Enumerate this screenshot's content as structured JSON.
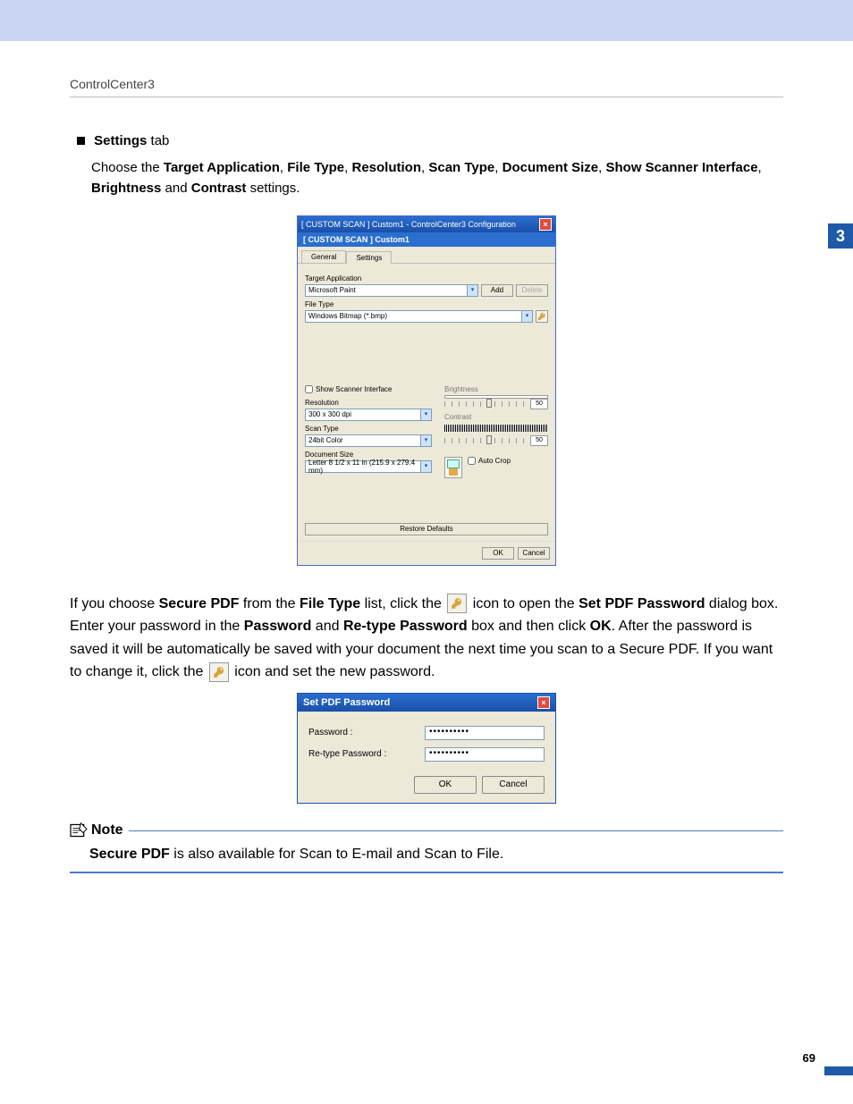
{
  "header": {
    "breadcrumb": "ControlCenter3"
  },
  "chapter_tab": "3",
  "section": {
    "title_bold": "Settings",
    "title_rest": " tab",
    "intro": {
      "pre": "Choose the ",
      "b1": "Target Application",
      "c1": ", ",
      "b2": "File Type",
      "c2": ", ",
      "b3": "Resolution",
      "c3": ", ",
      "b4": "Scan Type",
      "c4": ", ",
      "b5": "Document Size",
      "c5": ", ",
      "b6": "Show Scanner Interface",
      "c6": ", ",
      "b7": "Brightness",
      "c7": " and ",
      "b8": "Contrast",
      "c8": " settings."
    }
  },
  "dialog1": {
    "title": "[ CUSTOM SCAN ]   Custom1 - ControlCenter3 Configuration",
    "subtitle": "[ CUSTOM SCAN ]   Custom1",
    "tabs": {
      "general": "General",
      "settings": "Settings"
    },
    "target_app_label": "Target Application",
    "target_app_value": "Microsoft Paint",
    "add_btn": "Add",
    "delete_btn": "Delete",
    "file_type_label": "File Type",
    "file_type_value": "Windows Bitmap (*.bmp)",
    "show_scanner_label": "Show Scanner Interface",
    "resolution_label": "Resolution",
    "resolution_value": "300 x 300 dpi",
    "scan_type_label": "Scan Type",
    "scan_type_value": "24bit Color",
    "doc_size_label": "Document Size",
    "doc_size_value": "Letter 8 1/2 x 11 in (215.9 x 279.4 mm)",
    "brightness_label": "Brightness",
    "brightness_value": "50",
    "contrast_label": "Contrast",
    "contrast_value": "50",
    "auto_crop_label": "Auto Crop",
    "restore_btn": "Restore Defaults",
    "ok_btn": "OK",
    "cancel_btn": "Cancel"
  },
  "para1": {
    "pre": "If you choose ",
    "b1": "Secure PDF",
    "mid1": " from the ",
    "b2": "File Type",
    "mid2": " list, click the ",
    "mid3": " icon to open the ",
    "b3": "Set PDF Password",
    "mid4": " dialog box. Enter your password in the ",
    "b4": "Password",
    "mid5": " and ",
    "b5": "Re-type Password",
    "mid6": " box and then click ",
    "b6": "OK",
    "mid7": ". After the password is saved it will be automatically be saved with your document the next time you scan to a Secure PDF. If you want to change it, click the ",
    "mid8": " icon and set the new password."
  },
  "dialog2": {
    "title": "Set PDF Password",
    "password_label": "Password :",
    "retype_label": "Re-type Password :",
    "masked": "••••••••••",
    "ok_btn": "OK",
    "cancel_btn": "Cancel"
  },
  "note": {
    "heading": "Note",
    "b1": "Secure PDF",
    "text_rest": " is also available for Scan to E-mail and Scan to File."
  },
  "page_number": "69"
}
